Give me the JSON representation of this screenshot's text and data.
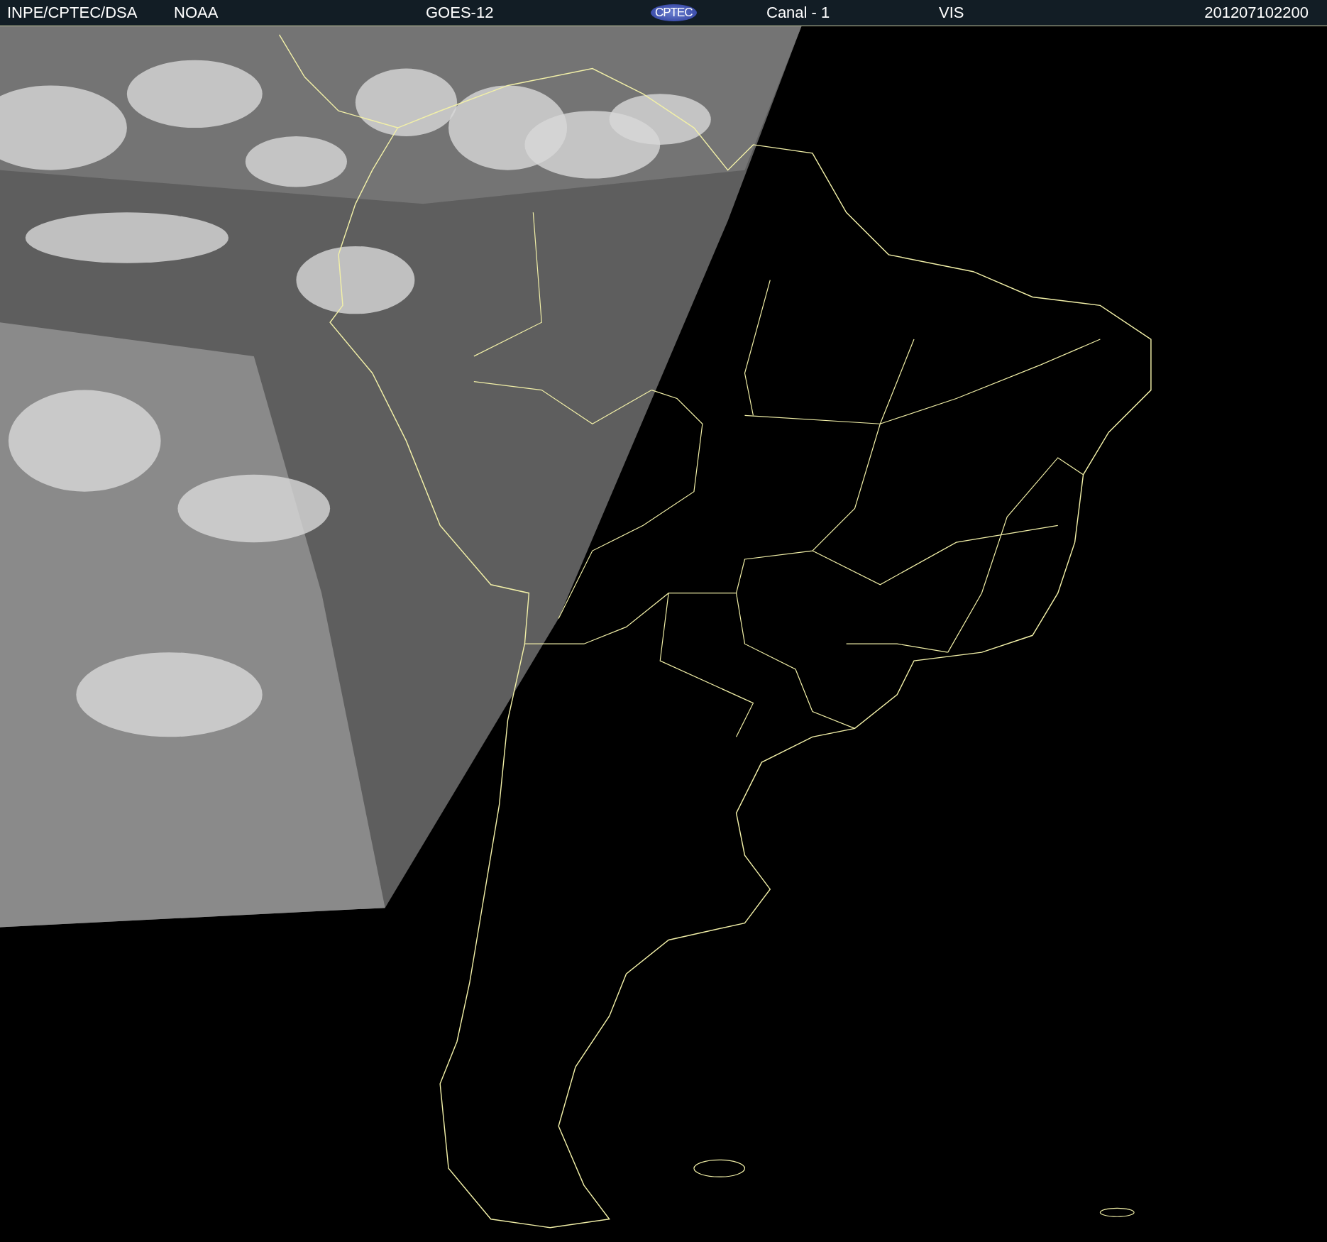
{
  "header": {
    "source": "INPE/CPTEC/DSA",
    "agency": "NOAA",
    "satellite": "GOES-12",
    "logo": "CPTEC",
    "channel": "Canal - 1",
    "band": "VIS",
    "timestamp": "201207102200"
  }
}
